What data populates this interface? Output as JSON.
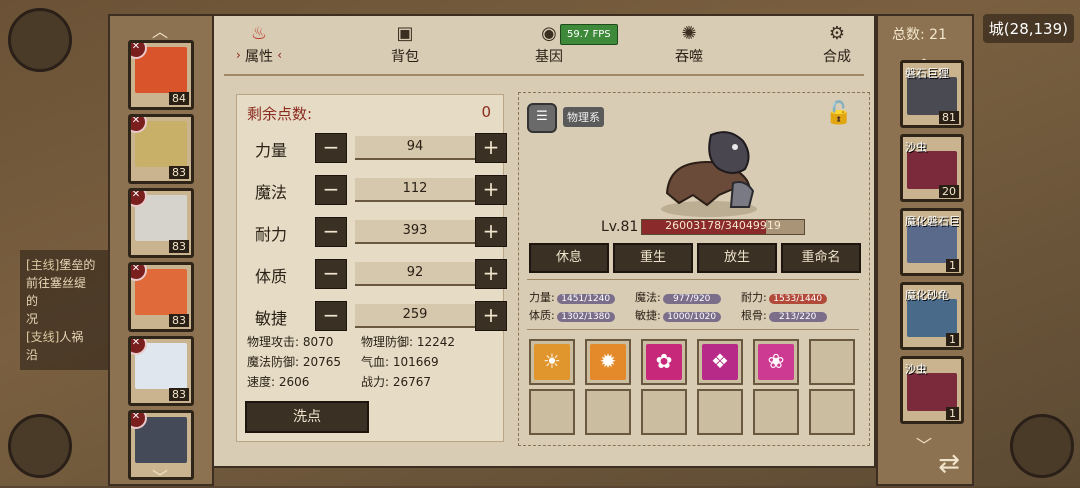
{
  "background": {
    "quest_lines": [
      {
        "tag": "[主线]",
        "text": "堡垒的",
        "note": ""
      },
      {
        "tag": "",
        "text": "前往塞丝缇",
        "note": ""
      },
      {
        "tag": "",
        "text": "的",
        "note": ""
      },
      {
        "tag": "",
        "text": "况",
        "note": ""
      },
      {
        "tag": "[支线]",
        "text": "人祸",
        "note": ""
      },
      {
        "tag": "",
        "text": "沿",
        "note": ""
      }
    ],
    "city_label": "城(28,139)"
  },
  "fps": "59.7 FPS",
  "tabs": [
    {
      "label": "属性",
      "icon": "attributes-icon",
      "active": true
    },
    {
      "label": "背包",
      "icon": "backpack-icon",
      "active": false
    },
    {
      "label": "基因",
      "icon": "gene-icon",
      "active": false
    },
    {
      "label": "吞噬",
      "icon": "devour-icon",
      "active": false
    },
    {
      "label": "合成",
      "icon": "synthesis-icon",
      "active": false
    }
  ],
  "roster": {
    "cards": [
      {
        "level": "84",
        "color": "#d9542b"
      },
      {
        "level": "83",
        "color": "#c9b069"
      },
      {
        "level": "83",
        "color": "#d6d2cc"
      },
      {
        "level": "83",
        "color": "#e06a3a"
      },
      {
        "level": "83",
        "color": "#dfe6ee"
      },
      {
        "level": "",
        "color": "#444a58"
      }
    ]
  },
  "attributes": {
    "remaining_label": "剩余点数:",
    "remaining_value": "0",
    "rows": [
      {
        "name": "力量",
        "value": "94"
      },
      {
        "name": "魔法",
        "value": "112"
      },
      {
        "name": "耐力",
        "value": "393"
      },
      {
        "name": "体质",
        "value": "92"
      },
      {
        "name": "敏捷",
        "value": "259"
      }
    ],
    "stats": [
      {
        "label": "物理攻击: 8070",
        "label2": "物理防御: 12242"
      },
      {
        "label": "魔法防御: 20765",
        "label2": "气血: 101669"
      },
      {
        "label": "速度: 2606",
        "label2": "战力: 26767"
      }
    ],
    "reset_label": "洗点"
  },
  "detail": {
    "type_badge": "物理系",
    "level": "Lv.81",
    "hp_text": "26003178/34049919",
    "hp_fraction": 0.7637,
    "actions": [
      "休息",
      "重生",
      "放生",
      "重命名"
    ],
    "growth": [
      {
        "label": "力量:",
        "value": "1451/1240"
      },
      {
        "label": "魔法:",
        "value": "977/920"
      },
      {
        "label": "耐力:",
        "value": "1533/1440"
      },
      {
        "label": "体质:",
        "value": "1302/1380"
      },
      {
        "label": "敏捷:",
        "value": "1000/1020"
      },
      {
        "label": "根骨:",
        "value": "213/220"
      }
    ],
    "skills": [
      {
        "icon": "sun-orb-skill-icon",
        "color": "#e0962c"
      },
      {
        "icon": "sunburst-skill-icon",
        "color": "#e48a2a"
      },
      {
        "icon": "vortex-skill-icon",
        "color": "#c8287a"
      },
      {
        "icon": "crystal-skill-icon",
        "color": "#b82a88"
      },
      {
        "icon": "lotus-skill-icon",
        "color": "#cc3a92"
      },
      {
        "icon": "",
        "color": ""
      }
    ]
  },
  "pets": {
    "count_label": "总数: 21",
    "items": [
      {
        "name": "磐石巨狸",
        "level": "81",
        "color": "#4a4a52"
      },
      {
        "name": "沙虫",
        "level": "20",
        "color": "#7a2a3a"
      },
      {
        "name": "魔化磐石巨狸",
        "level": "1",
        "color": "#5a6a8a"
      },
      {
        "name": "魔化砂龟",
        "level": "1",
        "color": "#4a6a8a"
      },
      {
        "name": "沙虫",
        "level": "1",
        "color": "#7a2a3a"
      }
    ]
  }
}
